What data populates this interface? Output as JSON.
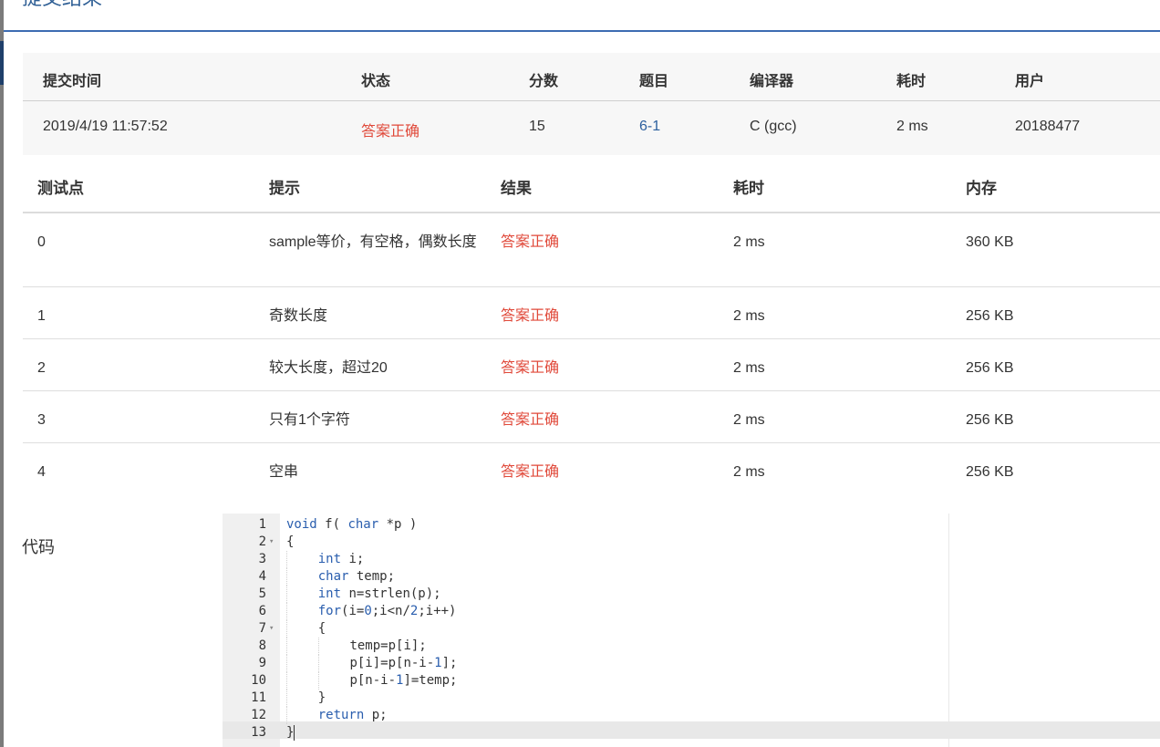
{
  "page": {
    "title": "提交结果"
  },
  "summary": {
    "headers": [
      "提交时间",
      "状态",
      "分数",
      "题目",
      "编译器",
      "耗时",
      "用户"
    ],
    "submit_time": "2019/4/19 11:57:52",
    "status": "答案正确",
    "score": "15",
    "problem": "6-1",
    "compiler": "C (gcc)",
    "time": "2 ms",
    "user": "20188477"
  },
  "tests": {
    "headers": [
      "测试点",
      "提示",
      "结果",
      "耗时",
      "内存"
    ],
    "rows": [
      {
        "id": "0",
        "hint": "sample等价，有空格，偶数长度",
        "result": "答案正确",
        "time": "2 ms",
        "memory": "360 KB"
      },
      {
        "id": "1",
        "hint": "奇数长度",
        "result": "答案正确",
        "time": "2 ms",
        "memory": "256 KB"
      },
      {
        "id": "2",
        "hint": "较大长度，超过20",
        "result": "答案正确",
        "time": "2 ms",
        "memory": "256 KB"
      },
      {
        "id": "3",
        "hint": "只有1个字符",
        "result": "答案正确",
        "time": "2 ms",
        "memory": "256 KB"
      },
      {
        "id": "4",
        "hint": "空串",
        "result": "答案正确",
        "time": "2 ms",
        "memory": "256 KB"
      }
    ]
  },
  "code": {
    "label": "代码",
    "line_numbers": [
      "1",
      "2",
      "3",
      "4",
      "5",
      "6",
      "7",
      "8",
      "9",
      "10",
      "11",
      "12",
      "13"
    ],
    "lines": [
      "void f( char *p )",
      "{",
      "    int i;",
      "    char temp;",
      "    int n=strlen(p);",
      "    for(i=0;i<n/2;i++)",
      "    {",
      "        temp=p[i];",
      "        p[i]=p[n-i-1];",
      "        p[n-i-1]=temp;",
      "    }",
      "    return p;",
      "}"
    ]
  },
  "colors": {
    "accent": "#3d6cb2",
    "success": "#e0493a",
    "link": "#2c5f9e"
  }
}
